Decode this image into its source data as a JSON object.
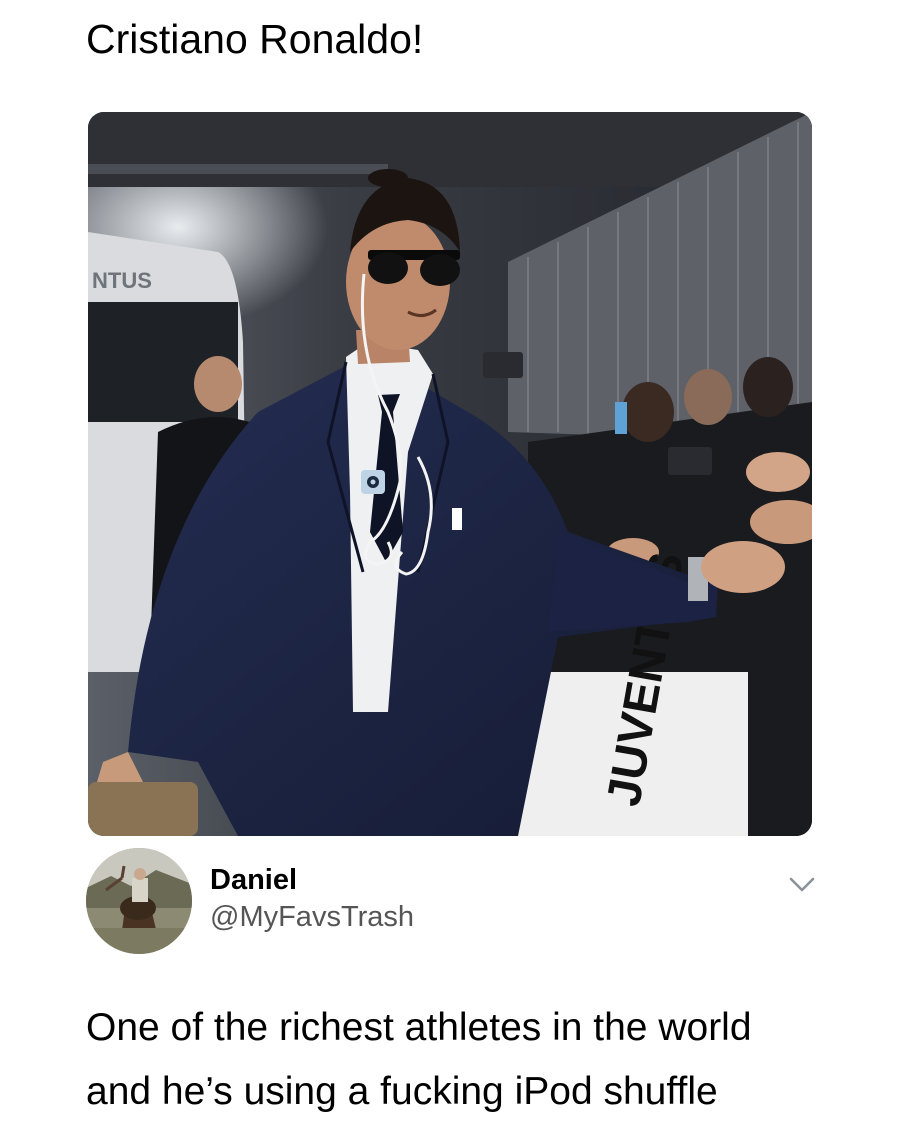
{
  "post": {
    "caption": "Cristiano Ronaldo!"
  },
  "tweet": {
    "author_name": "Daniel",
    "author_handle": "@MyFavsTrash",
    "text_line1": "One of the richest athletes in the world",
    "text_line2": "and he’s using a fucking iPod shuffle"
  },
  "photo": {
    "subject": "ronaldo-suit-photo",
    "bus_sign": "NTUS",
    "barrier_text": "JUVENTUS"
  },
  "icons": {
    "menu": "chevron-down-icon",
    "avatar": "user-avatar"
  },
  "colors": {
    "text": "#000000",
    "handle": "#555555",
    "suit": "#1c2340",
    "chevron": "#8a9199"
  }
}
